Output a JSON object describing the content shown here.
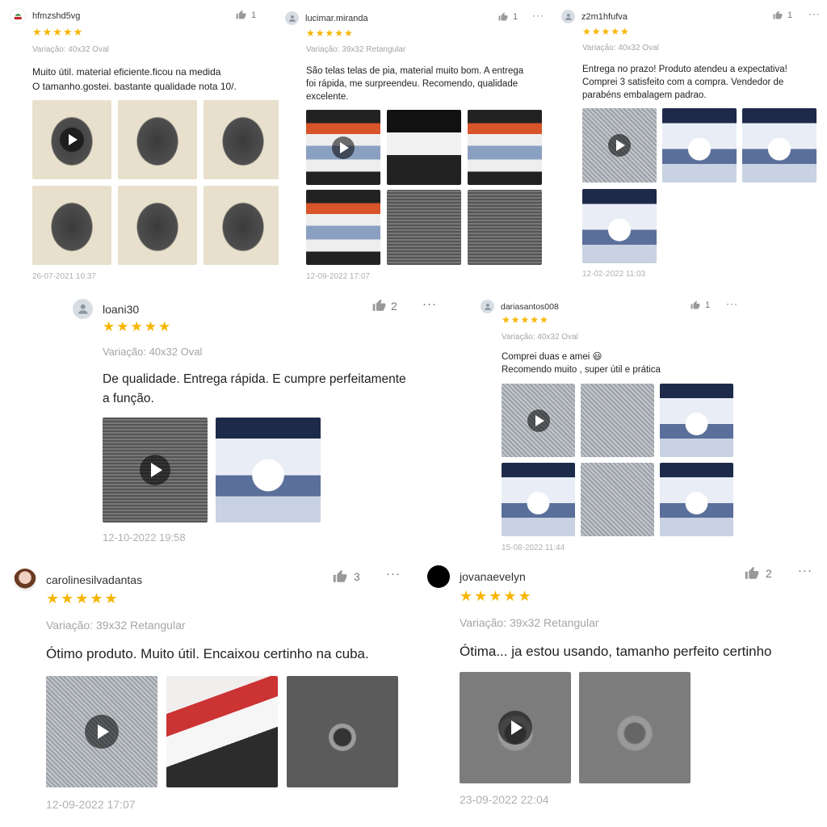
{
  "reviews": [
    {
      "username": "hfmzshd5vg",
      "avatar": "logo-avatar",
      "likes": "1",
      "rating": 5,
      "stars": "★★★★★",
      "variation": "Variação: 40x32 Oval",
      "text_lines": [
        "Muito útil. material eficiente.ficou na medida",
        "O tamanho.gostei. bastante qualidade nota 10/."
      ],
      "media": [
        {
          "kind": "video",
          "thumb": "mesh screen on patterned cloth"
        },
        {
          "kind": "photo",
          "thumb": "mesh screen on patterned cloth"
        },
        {
          "kind": "photo",
          "thumb": "mesh screen on patterned cloth"
        },
        {
          "kind": "photo",
          "thumb": "mesh screen on patterned cloth"
        },
        {
          "kind": "photo",
          "thumb": "mesh screen on patterned cloth"
        },
        {
          "kind": "photo",
          "thumb": "mesh screen on patterned cloth"
        }
      ],
      "date": "26-07-2021 10:37"
    },
    {
      "username": "lucimar.miranda",
      "avatar": "default-avatar",
      "likes": "1",
      "rating": 5,
      "stars": "★★★★★",
      "variation": "Variação: 39x32 Retangular",
      "text_lines": [
        "São telas telas de pia, material muito bom. A entrega",
        "foi rápida, me surpreendeu. Recomendo, qualidade",
        "excelente."
      ],
      "media": [
        {
          "kind": "video",
          "thumb": "packaged screens"
        },
        {
          "kind": "photo",
          "thumb": "shipping box"
        },
        {
          "kind": "photo",
          "thumb": "product package"
        },
        {
          "kind": "photo",
          "thumb": "product package"
        },
        {
          "kind": "photo",
          "thumb": "mesh screen"
        },
        {
          "kind": "photo",
          "thumb": "mesh screen"
        }
      ],
      "date": "12-09-2022 17:07"
    },
    {
      "username": "z2m1hfufva",
      "avatar": "default-avatar",
      "likes": "1",
      "rating": 5,
      "stars": "★★★★★",
      "variation": "Variação: 40x32 Oval",
      "text_lines": [
        "Entrega no prazo! Produto atendeu a expectativa!",
        "Comprei 3 satisfeito com a compra. Vendedor de",
        "parabéns embalagem padrao."
      ],
      "media": [
        {
          "kind": "video",
          "thumb": "packaged screen"
        },
        {
          "kind": "photo",
          "thumb": "product package"
        },
        {
          "kind": "photo",
          "thumb": "packaged screen"
        },
        {
          "kind": "photo",
          "thumb": "packaged screen"
        }
      ],
      "date": "12-02-2022 11:03"
    },
    {
      "username": "loani30",
      "avatar": "default-avatar",
      "likes": "2",
      "rating": 5,
      "stars": "★★★★★",
      "variation": "Variação: 40x32 Oval",
      "text_lines": [
        "De qualidade. Entrega rápida. E cumpre perfeitamente",
        "a função."
      ],
      "media": [
        {
          "kind": "video",
          "thumb": "mesh screen close-up"
        },
        {
          "kind": "photo",
          "thumb": "product package"
        }
      ],
      "date": "12-10-2022 19:58"
    },
    {
      "username": "dariasantos008",
      "avatar": "default-avatar",
      "likes": "1",
      "rating": 5,
      "stars": "★★★★★",
      "variation": "Variação: 40x32 Oval",
      "text_lines": [
        "Comprei duas e amei 😃",
        "Recomendo muito , super útil e prática"
      ],
      "media": [
        {
          "kind": "video",
          "thumb": "mesh screen"
        },
        {
          "kind": "photo",
          "thumb": "mesh screen"
        },
        {
          "kind": "photo",
          "thumb": "packaged screen"
        },
        {
          "kind": "photo",
          "thumb": "packaged screen"
        },
        {
          "kind": "photo",
          "thumb": "mesh screen"
        },
        {
          "kind": "photo",
          "thumb": "packaged screen"
        }
      ],
      "date": "15-08-2022 11:44"
    },
    {
      "username": "carolinesilvadantas",
      "avatar": "photo-avatar",
      "likes": "3",
      "rating": 5,
      "stars": "★★★★★",
      "variation": "Variação: 39x32 Retangular",
      "text_lines": [
        "Ótimo produto. Muito útil.  Encaixou certinho na cuba."
      ],
      "media": [
        {
          "kind": "video",
          "thumb": "mesh close-up"
        },
        {
          "kind": "photo",
          "thumb": "packaged screen"
        },
        {
          "kind": "photo",
          "thumb": "screen in sink"
        }
      ],
      "date": "12-09-2022 17:07"
    },
    {
      "username": "jovanaevelyn",
      "avatar": "black-avatar",
      "likes": "2",
      "rating": 5,
      "stars": "★★★★★",
      "variation": "Variação: 39x32 Retangular",
      "text_lines": [
        "Ótima... ja estou usando, tamanho perfeito certinho"
      ],
      "media": [
        {
          "kind": "video",
          "thumb": "screen in sink"
        },
        {
          "kind": "photo",
          "thumb": "screen in sink"
        }
      ],
      "date": "23-09-2022 22:04"
    }
  ],
  "colors": {
    "star": "#f7b500",
    "muted_text": "#a5a5a5",
    "date_text": "#b0b0b0"
  },
  "icons": {
    "like": "thumbs-up-icon",
    "more": "more-icon",
    "play": "play-icon",
    "avatar_default": "person-icon"
  }
}
